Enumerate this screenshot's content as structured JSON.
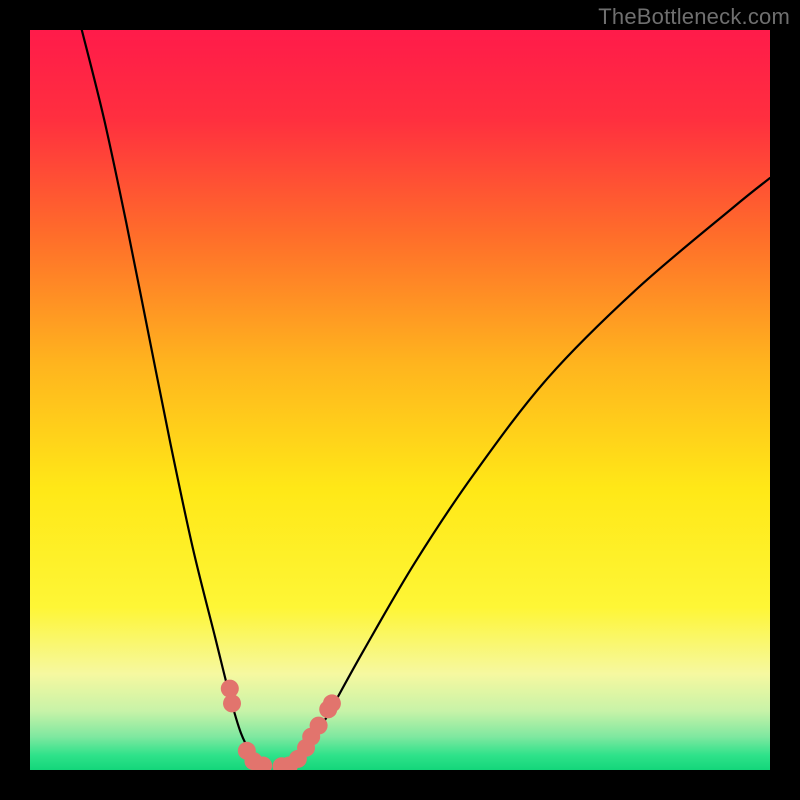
{
  "watermark": {
    "text": "TheBottleneck.com"
  },
  "gradient": {
    "stops": [
      {
        "offset": 0.0,
        "color": "#ff1b4a"
      },
      {
        "offset": 0.12,
        "color": "#ff2f3f"
      },
      {
        "offset": 0.28,
        "color": "#ff6e2a"
      },
      {
        "offset": 0.45,
        "color": "#ffb41e"
      },
      {
        "offset": 0.62,
        "color": "#ffe817"
      },
      {
        "offset": 0.78,
        "color": "#fef636"
      },
      {
        "offset": 0.87,
        "color": "#f6f8a0"
      },
      {
        "offset": 0.92,
        "color": "#c8f3a8"
      },
      {
        "offset": 0.955,
        "color": "#7fe8a0"
      },
      {
        "offset": 0.98,
        "color": "#2fe28a"
      },
      {
        "offset": 1.0,
        "color": "#13d67a"
      }
    ]
  },
  "chart_data": {
    "type": "line",
    "title": "",
    "xlabel": "",
    "ylabel": "",
    "xlim": [
      0,
      100
    ],
    "ylim": [
      0,
      100
    ],
    "grid": false,
    "series": [
      {
        "name": "left-curve",
        "x": [
          7,
          10,
          13,
          16,
          19,
          22,
          25,
          27,
          28.5,
          30,
          31.5
        ],
        "y": [
          100,
          88,
          74,
          59,
          44,
          30,
          18,
          10,
          5,
          2,
          0
        ]
      },
      {
        "name": "right-curve",
        "x": [
          35,
          37,
          40,
          45,
          52,
          60,
          70,
          82,
          95,
          100
        ],
        "y": [
          0,
          2,
          7,
          16,
          28,
          40,
          53,
          65,
          76,
          80
        ]
      }
    ],
    "markers": [
      {
        "name": "left-markers",
        "color": "#e2746d",
        "points": [
          {
            "x": 27.0,
            "y": 11.0
          },
          {
            "x": 27.3,
            "y": 9.0
          },
          {
            "x": 29.3,
            "y": 2.6
          },
          {
            "x": 30.2,
            "y": 1.2
          },
          {
            "x": 31.5,
            "y": 0.6
          }
        ]
      },
      {
        "name": "right-markers",
        "color": "#e2746d",
        "points": [
          {
            "x": 34.0,
            "y": 0.5
          },
          {
            "x": 35.0,
            "y": 0.6
          },
          {
            "x": 36.2,
            "y": 1.5
          },
          {
            "x": 37.3,
            "y": 3.0
          },
          {
            "x": 38.0,
            "y": 4.5
          },
          {
            "x": 39.0,
            "y": 6.0
          },
          {
            "x": 40.3,
            "y": 8.2
          },
          {
            "x": 40.8,
            "y": 9.0
          }
        ]
      }
    ]
  }
}
